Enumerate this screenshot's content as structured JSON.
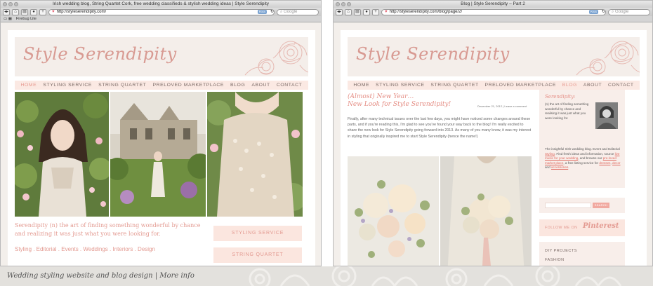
{
  "left": {
    "window_title": "Irish wedding blog, String Quartet Cork, free wedding classifieds & stylish wedding ideas | Style Serendipity",
    "url": "http://styleserendipity.com/",
    "search_placeholder": "Google",
    "rss": "RSS",
    "bookmark": "Firebug Lite",
    "logo": "Style Serendipity",
    "nav": [
      "HOME",
      "STYLING SERVICE",
      "STRING QUARTET",
      "PRELOVED MARKETPLACE",
      "BLOG",
      "ABOUT",
      "CONTACT"
    ],
    "tagline": "Serendipity (n) the art of finding something wonderful by chance and realizing it was just what you were looking for.",
    "links": "Styling . Editorial . Events . Weddings . Interiors . Design",
    "cta_1": "STYLING SERVICE",
    "cta_2": "STRING QUARTET"
  },
  "right": {
    "window_title": "Blog | Style Serendipity – Part 2",
    "url": "http://styleserendipity.com/blog/page/2/",
    "search_placeholder": "Google",
    "rss": "RSS",
    "logo": "Style Serendipity",
    "nav": [
      "HOME",
      "STYLING SERVICE",
      "STRING QUARTET",
      "PRELOVED MARKETPLACE",
      "BLOG",
      "ABOUT",
      "CONTACT"
    ],
    "post_title_1": "(Almost) New Year…",
    "post_title_2": "New Look for Style Serendipity!",
    "post_date": "December 21, 2012 | Leave a comment",
    "post_body": "Finally, after many technical issues over the last few days, you might have noticed some changes around these parts, and if you're reading this, I'm glad to see you've found your way back to the blog! I'm really excited to share the new look for Style Serendipity going forward into 2013. As many of you many know, it was my interest in styling that originally inspired me to start Style Serendipity (hence the name!)",
    "sidebar_title": "Serendipity:",
    "sidebar_text": "(n) the art of finding something wonderful by chance and realising it was just what you were looking for.",
    "sidebar_text2_a": "The insightful Irish wedding blog. Event and Editorial ",
    "sidebar_link_styling": "Styling",
    "sidebar_text2_b": ". Find fresh ideas and information, source ",
    "sidebar_link_music": "live music for your wedding",
    "sidebar_text2_c": ", and browse our ",
    "sidebar_link_market": "pre-loved market place",
    "sidebar_text2_d": ", a free listing service for ",
    "sidebar_link_dresses": "dresses",
    "sidebar_text2_e": ", ",
    "sidebar_link_decor": "decor",
    "sidebar_text2_f": " and ",
    "sidebar_link_acc": "accessories",
    "sidebar_text2_g": ".",
    "search_button": "SEARCH",
    "follow_label": "FOLLOW ME ON",
    "pinterest": "Pinterest",
    "categories": [
      "DIY PROJECTS",
      "FASHION"
    ]
  },
  "footer": "Wedding styling website and blog design | More info"
}
